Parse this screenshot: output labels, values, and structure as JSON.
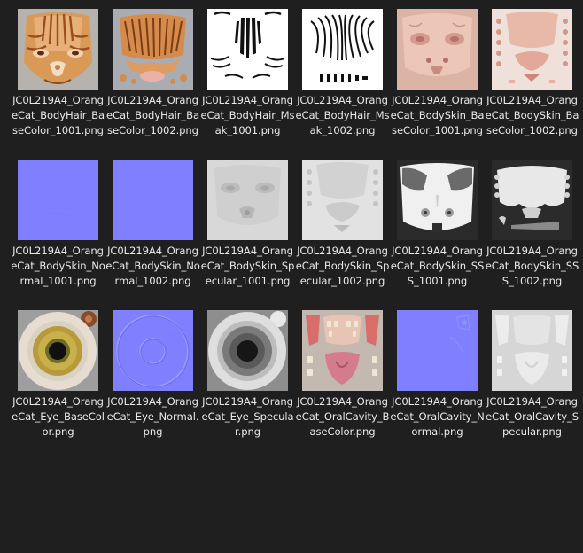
{
  "files": [
    {
      "name": "JC0L219A4_OrangeCat_BodyHair_BaseColor_1001.png",
      "thumb_icon": "cat-fur-basecolor-1001-thumbnail-icon"
    },
    {
      "name": "JC0L219A4_OrangeCat_BodyHair_BaseColor_1002.png",
      "thumb_icon": "cat-fur-basecolor-1002-thumbnail-icon"
    },
    {
      "name": "JC0L219A4_OrangeCat_BodyHair_Msak_1001.png",
      "thumb_icon": "fur-mask-1001-thumbnail-icon"
    },
    {
      "name": "JC0L219A4_OrangeCat_BodyHair_Msak_1002.png",
      "thumb_icon": "fur-mask-1002-thumbnail-icon"
    },
    {
      "name": "JC0L219A4_OrangeCat_BodySkin_BaseColor_1001.png",
      "thumb_icon": "skin-basecolor-1001-thumbnail-icon"
    },
    {
      "name": "JC0L219A4_OrangeCat_BodySkin_BaseColor_1002.png",
      "thumb_icon": "skin-basecolor-1002-thumbnail-icon"
    },
    {
      "name": "JC0L219A4_OrangeCat_BodySkin_Normal_1001.png",
      "thumb_icon": "skin-normal-1001-thumbnail-icon"
    },
    {
      "name": "JC0L219A4_OrangeCat_BodySkin_Normal_1002.png",
      "thumb_icon": "skin-normal-1002-thumbnail-icon"
    },
    {
      "name": "JC0L219A4_OrangeCat_BodySkin_Specular_1001.png",
      "thumb_icon": "skin-specular-1001-thumbnail-icon"
    },
    {
      "name": "JC0L219A4_OrangeCat_BodySkin_Specular_1002.png",
      "thumb_icon": "skin-specular-1002-thumbnail-icon"
    },
    {
      "name": "JC0L219A4_OrangeCat_BodySkin_SSS_1001.png",
      "thumb_icon": "skin-sss-1001-thumbnail-icon"
    },
    {
      "name": "JC0L219A4_OrangeCat_BodySkin_SSS_1002.png",
      "thumb_icon": "skin-sss-1002-thumbnail-icon"
    },
    {
      "name": "JC0L219A4_OrangeCat_Eye_BaseColor.png",
      "thumb_icon": "eye-basecolor-thumbnail-icon"
    },
    {
      "name": "JC0L219A4_OrangeCat_Eye_Normal.png",
      "thumb_icon": "eye-normal-thumbnail-icon"
    },
    {
      "name": "JC0L219A4_OrangeCat_Eye_Specular.png",
      "thumb_icon": "eye-specular-thumbnail-icon"
    },
    {
      "name": "JC0L219A4_OrangeCat_OralCavity_BaseColor.png",
      "thumb_icon": "oral-basecolor-thumbnail-icon"
    },
    {
      "name": "JC0L219A4_OrangeCat_OralCavity_Normal.png",
      "thumb_icon": "oral-normal-thumbnail-icon"
    },
    {
      "name": "JC0L219A4_OrangeCat_OralCavity_Specular.png",
      "thumb_icon": "oral-specular-thumbnail-icon"
    }
  ],
  "colors": {
    "background": "#1f1f1f",
    "caption_text": "#e8e8e8",
    "normal_map_blue": "#7f7fff",
    "thumb_gray_bg": "#a9a9a9",
    "fur_orange": "#d8924f"
  }
}
